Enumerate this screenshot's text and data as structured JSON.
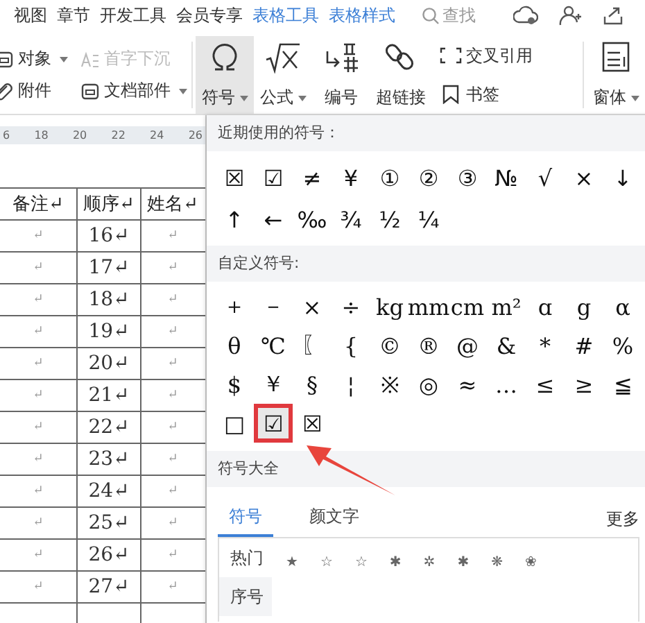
{
  "menu_bar": {
    "items": [
      {
        "label": "视图",
        "kind": "plain"
      },
      {
        "label": "章节",
        "kind": "plain"
      },
      {
        "label": "开发工具",
        "kind": "plain"
      },
      {
        "label": "会员专享",
        "kind": "plain"
      },
      {
        "label": "表格工具",
        "kind": "context"
      },
      {
        "label": "表格样式",
        "kind": "context"
      }
    ],
    "search": "查找"
  },
  "ribbon": {
    "small_items": [
      {
        "label": "对象",
        "dropdown": true,
        "disabled": false
      },
      {
        "label": "首字下沉",
        "dropdown": false,
        "disabled": true
      },
      {
        "label": "附件",
        "dropdown": false,
        "disabled": false
      },
      {
        "label": "文档部件",
        "dropdown": true,
        "disabled": false
      }
    ],
    "big_items": [
      {
        "label": "符号",
        "dropdown": true,
        "selected": true
      },
      {
        "label": "公式",
        "dropdown": true,
        "selected": false
      },
      {
        "label": "编号",
        "dropdown": false,
        "selected": false
      },
      {
        "label": "超链接",
        "dropdown": false,
        "selected": false
      }
    ],
    "pair_items": [
      {
        "label": "交叉引用"
      },
      {
        "label": "书签"
      }
    ],
    "form_item": {
      "label": "窗体",
      "dropdown": true
    }
  },
  "ruler": [
    "6",
    "18",
    "20",
    "22",
    "24",
    "26"
  ],
  "table": {
    "columns": [
      "备注↵",
      "顺序↵",
      "姓名↵"
    ],
    "rows": [
      [
        "↵",
        "16↵",
        "↵"
      ],
      [
        "↵",
        "17↵",
        "↵"
      ],
      [
        "↵",
        "18↵",
        "↵"
      ],
      [
        "↵",
        "19↵",
        "↵"
      ],
      [
        "↵",
        "20↵",
        "↵"
      ],
      [
        "↵",
        "21↵",
        "↵"
      ],
      [
        "↵",
        "22↵",
        "↵"
      ],
      [
        "↵",
        "23↵",
        "↵"
      ],
      [
        "↵",
        "24↵",
        "↵"
      ],
      [
        "↵",
        "25↵",
        "↵"
      ],
      [
        "↵",
        "26↵",
        "↵"
      ],
      [
        "↵",
        "27↵",
        "↵"
      ]
    ]
  },
  "symbol_panel": {
    "recent_title": "近期使用的符号：",
    "recent": [
      "☒",
      "☑",
      "≠",
      "¥",
      "①",
      "②",
      "③",
      "№",
      "√",
      "×",
      "↓",
      "↑",
      "←",
      "‰",
      "¾",
      "½",
      "¼"
    ],
    "custom_title": "自定义符号:",
    "custom": [
      {
        "symbol": "＋",
        "selected": false
      },
      {
        "symbol": "－",
        "selected": false
      },
      {
        "symbol": "×",
        "selected": false
      },
      {
        "symbol": "÷",
        "selected": false
      },
      {
        "symbol": "kg",
        "selected": false
      },
      {
        "symbol": "mm",
        "selected": false
      },
      {
        "symbol": "cm",
        "selected": false
      },
      {
        "symbol": "m²",
        "selected": false
      },
      {
        "symbol": "ɑ",
        "selected": false
      },
      {
        "symbol": "g",
        "selected": false
      },
      {
        "symbol": "α",
        "selected": false
      },
      {
        "symbol": "θ",
        "selected": false
      },
      {
        "symbol": "℃",
        "selected": false
      },
      {
        "symbol": "〖",
        "selected": false
      },
      {
        "symbol": "{",
        "selected": false
      },
      {
        "symbol": "©",
        "selected": false
      },
      {
        "symbol": "®",
        "selected": false
      },
      {
        "symbol": "@",
        "selected": false
      },
      {
        "symbol": "&",
        "selected": false
      },
      {
        "symbol": "*",
        "selected": false
      },
      {
        "symbol": "#",
        "selected": false
      },
      {
        "symbol": "%",
        "selected": false
      },
      {
        "symbol": "$",
        "selected": false
      },
      {
        "symbol": "￥",
        "selected": false
      },
      {
        "symbol": "§",
        "selected": false
      },
      {
        "symbol": "¦",
        "selected": false
      },
      {
        "symbol": "※",
        "selected": false
      },
      {
        "symbol": "◎",
        "selected": false
      },
      {
        "symbol": "≈",
        "selected": false
      },
      {
        "symbol": "…",
        "selected": false
      },
      {
        "symbol": "≤",
        "selected": false
      },
      {
        "symbol": "≥",
        "selected": false
      },
      {
        "symbol": "≦",
        "selected": false
      },
      {
        "symbol": "□",
        "selected": false
      },
      {
        "symbol": "☑",
        "selected": true
      },
      {
        "symbol": "☒",
        "selected": false
      }
    ],
    "all_title": "符号大全",
    "tabs": [
      {
        "label": "符号",
        "selected": true
      },
      {
        "label": "颜文字",
        "selected": false
      }
    ],
    "more": "更多",
    "categories": [
      {
        "label": "热门",
        "selected": true
      },
      {
        "label": "序号",
        "selected": false
      }
    ],
    "hot_symbols": [
      "★",
      "☆",
      "☆",
      "✱",
      "✲",
      "✱",
      "❋",
      "❀"
    ]
  }
}
